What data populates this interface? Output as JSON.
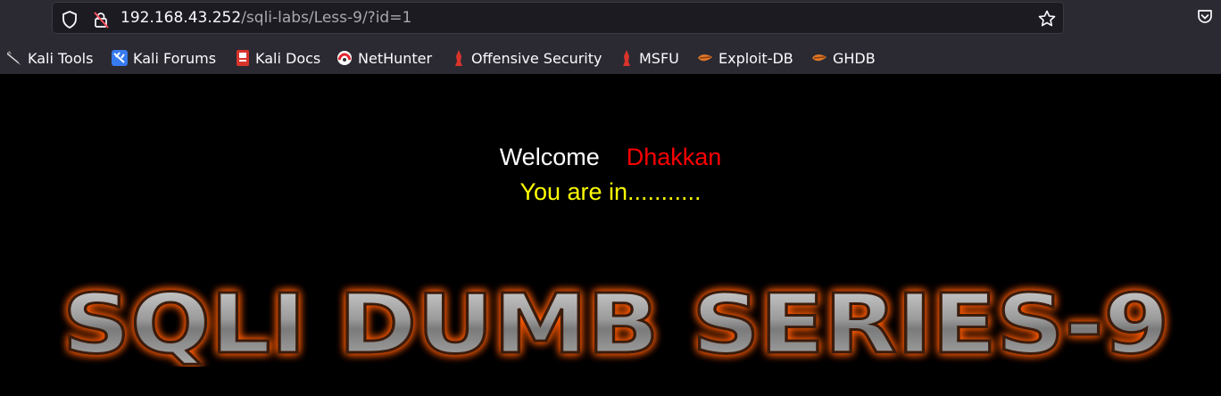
{
  "browser": {
    "url_host": "192.168.43.252",
    "url_path": "/sqli-labs/Less-9/?id=1",
    "icons": [
      "shield-icon",
      "insecure-lock-icon",
      "bookmark-star-icon",
      "pocket-icon"
    ]
  },
  "bookmarks": [
    {
      "label": "Kali Tools",
      "icon": "kali-tools-icon"
    },
    {
      "label": "Kali Forums",
      "icon": "kali-forums-icon"
    },
    {
      "label": "Kali Docs",
      "icon": "kali-docs-icon"
    },
    {
      "label": "NetHunter",
      "icon": "nethunter-icon"
    },
    {
      "label": "Offensive Security",
      "icon": "offsec-icon"
    },
    {
      "label": "MSFU",
      "icon": "msfu-icon"
    },
    {
      "label": "Exploit-DB",
      "icon": "exploit-db-icon"
    },
    {
      "label": "GHDB",
      "icon": "ghdb-icon"
    }
  ],
  "page": {
    "welcome": "Welcome",
    "name": "Dhakkan",
    "status": "You are in...........",
    "banner": "SQLI DUMB SERIES-9",
    "colors": {
      "background": "#000000",
      "welcome": "#ffffff",
      "name": "#ff0000",
      "status": "#ffff00",
      "banner_glow": "#ff5a00"
    }
  }
}
